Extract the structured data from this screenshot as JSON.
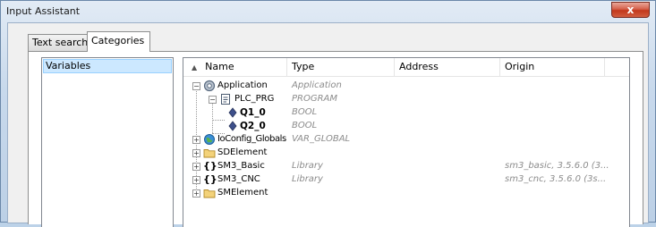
{
  "window": {
    "title": "Input Assistant",
    "close_label": "x"
  },
  "tabs": [
    {
      "label": "Text search",
      "active": false
    },
    {
      "label": "Categories",
      "active": true
    }
  ],
  "categories": {
    "items": [
      {
        "label": "Variables",
        "selected": true
      }
    ]
  },
  "tree": {
    "columns": {
      "name": "Name",
      "type": "Type",
      "address": "Address",
      "origin": "Origin"
    },
    "sort_column": "Name",
    "rows": [
      {
        "name": "Application",
        "type": "Application",
        "origin": "",
        "icon": "application-gear-icon",
        "expander": "minus"
      },
      {
        "name": "PLC_PRG",
        "type": "PROGRAM",
        "origin": "",
        "icon": "program-document-icon",
        "expander": "minus"
      },
      {
        "name": "Q1_0",
        "type": "BOOL",
        "origin": "",
        "icon": "variable-diamond-icon",
        "expander": ""
      },
      {
        "name": "Q2_0",
        "type": "BOOL",
        "origin": "",
        "icon": "variable-diamond-icon",
        "expander": ""
      },
      {
        "name": "IoConfig_Globals",
        "type": "VAR_GLOBAL",
        "origin": "",
        "icon": "globe-icon",
        "expander": "plus"
      },
      {
        "name": "SDElement",
        "type": "",
        "origin": "",
        "icon": "folder-icon",
        "expander": "plus"
      },
      {
        "name": "SM3_Basic",
        "type": "Library",
        "origin": "sm3_basic, 3.5.6.0 (3...",
        "icon": "library-braces-icon",
        "expander": "plus"
      },
      {
        "name": "SM3_CNC",
        "type": "Library",
        "origin": "sm3_cnc, 3.5.6.0 (3s...",
        "icon": "library-braces-icon",
        "expander": "plus"
      },
      {
        "name": "SMElement",
        "type": "",
        "origin": "",
        "icon": "folder-icon",
        "expander": "plus"
      }
    ]
  },
  "colors": {
    "selection": "#cce8ff",
    "type_text": "#8c8c8c",
    "close_button": "#c2381c"
  }
}
